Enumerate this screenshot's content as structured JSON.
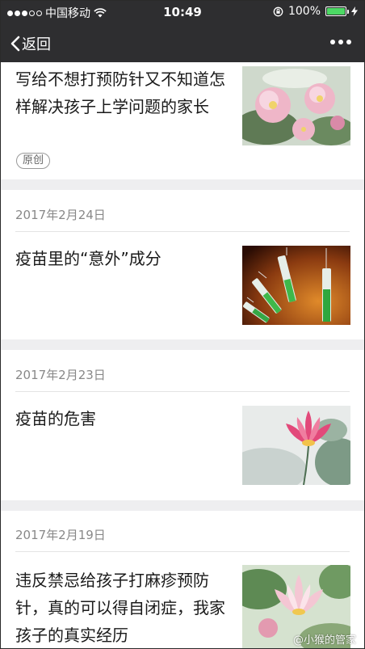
{
  "statusbar": {
    "carrier": "中国移动",
    "time": "10:49",
    "battery_text": "100%",
    "battery_level": 1.0,
    "signal_bars_filled": 3,
    "signal_bars_total": 5
  },
  "navbar": {
    "back_label": "返回"
  },
  "articles": [
    {
      "title": "写给不想打预防针又不知道怎样解决孩子上学问题的家长",
      "tag": "原创",
      "thumb": "peony-painting"
    },
    {
      "date": "2017年2月24日",
      "title": "疫苗里的“意外”成分",
      "thumb": "syringes-photo"
    },
    {
      "date": "2017年2月23日",
      "title": "疫苗的危害",
      "thumb": "lotus-painting"
    },
    {
      "date": "2017年2月19日",
      "title": "违反禁忌给孩子打麻疹预防针，真的可以得自闭症，我家孩子的真实经历",
      "thumb": "lotus-watercolor"
    }
  ],
  "watermark": "@小猴的管家",
  "colors": {
    "bar_background": "#2e2e30",
    "separator": "#eeeef0",
    "date_text": "#888888",
    "battery_green": "#4cd964"
  }
}
